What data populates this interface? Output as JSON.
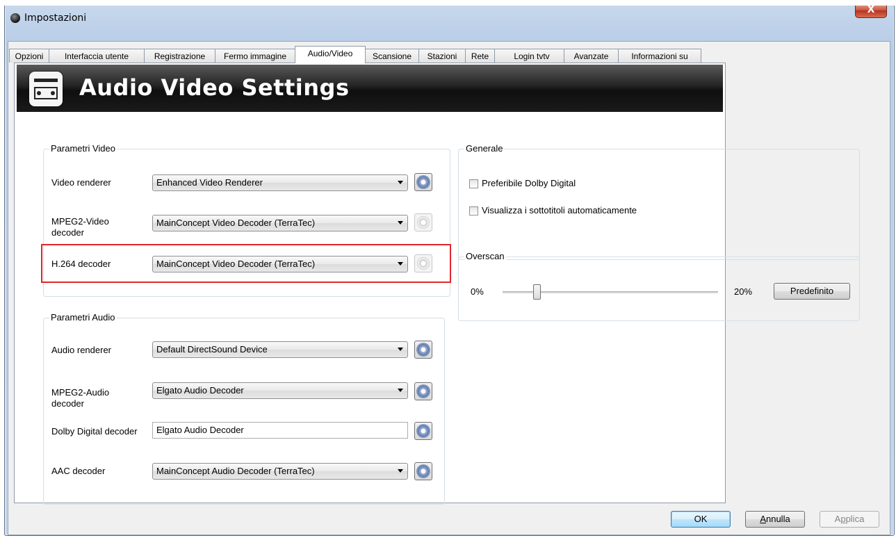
{
  "window": {
    "title": "Impostazioni",
    "close_label": "X"
  },
  "tabs": [
    "Opzioni",
    "Interfaccia utente",
    "Registrazione",
    "Fermo immagine",
    "Audio/Video",
    "Scansione",
    "Stazioni",
    "Rete",
    "Login tvtv",
    "Avanzate",
    "Informazioni su"
  ],
  "active_tab": "Audio/Video",
  "banner": {
    "title": "Audio Video Settings",
    "icon": "av-device-icon"
  },
  "video": {
    "legend": "Parametri Video",
    "renderer_label": "Video renderer",
    "renderer_value": "Enhanced Video Renderer",
    "mpeg2_label_1": "MPEG2-Video",
    "mpeg2_label_2": "decoder",
    "mpeg2_value": "MainConcept Video Decoder (TerraTec)",
    "h264_label": "H.264 decoder",
    "h264_value": "MainConcept Video Decoder (TerraTec)"
  },
  "audio": {
    "legend": "Parametri Audio",
    "renderer_label": "Audio renderer",
    "renderer_value": "Default DirectSound Device",
    "mpeg2_label_1": "MPEG2-Audio",
    "mpeg2_label_2": "decoder",
    "mpeg2_value": "Elgato Audio Decoder",
    "dolby_label": "Dolby Digital decoder",
    "dolby_value": "Elgato Audio Decoder",
    "aac_label": "AAC decoder",
    "aac_value": "MainConcept Audio Decoder (TerraTec)"
  },
  "general": {
    "legend": "Generale",
    "dolby_pref": "Preferibile Dolby Digital",
    "auto_subtitles": "Visualizza i sottotitoli automaticamente"
  },
  "overscan": {
    "legend": "Overscan",
    "min_label": "0%",
    "max_label": "20%",
    "value_percent": 4,
    "default_button": "Predefinito"
  },
  "footer": {
    "ok": "OK",
    "cancel_first": "A",
    "cancel_rest": "nnulla",
    "apply_pre": "A",
    "apply_u": "p",
    "apply_post": "plica"
  },
  "colors": {
    "highlight": "#e0262c",
    "banner_bg": "#1a1a1a"
  }
}
